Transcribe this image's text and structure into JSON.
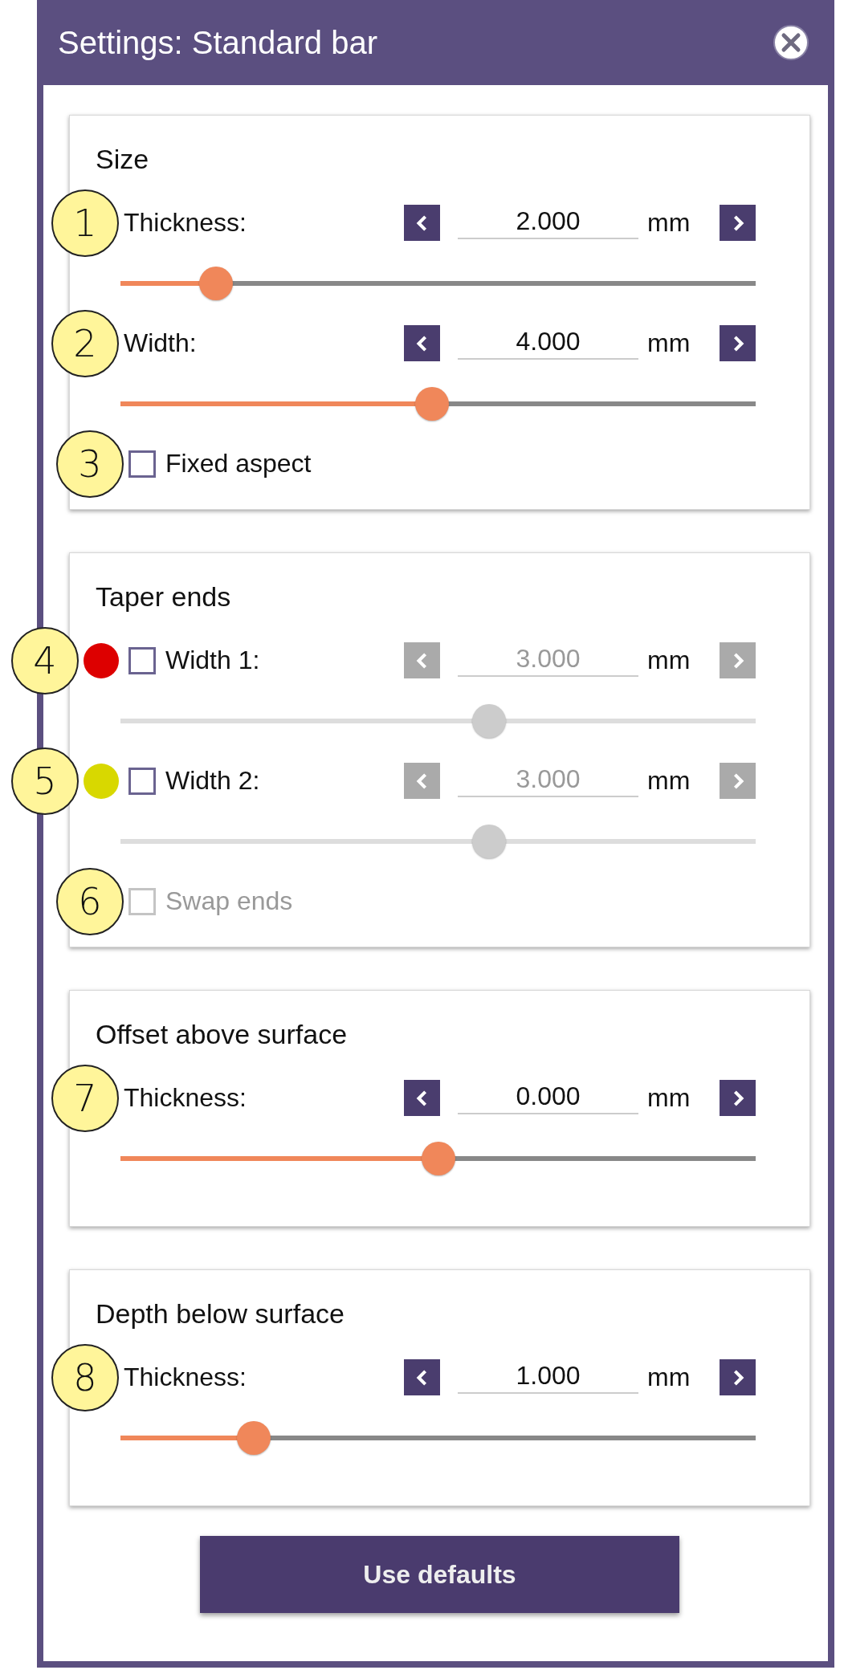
{
  "window": {
    "title": "Settings: Standard bar"
  },
  "panels": [
    {
      "title": "Size",
      "items": [
        {
          "kind": "value",
          "callout": "1",
          "label": "Thickness:",
          "value": "2.000",
          "unit": "mm",
          "level": 0.15,
          "disabled": false
        },
        {
          "kind": "value",
          "callout": "2",
          "label": "Width:",
          "value": "4.000",
          "unit": "mm",
          "level": 0.49,
          "disabled": false
        },
        {
          "kind": "checkbox",
          "callout": "3",
          "label": "Fixed aspect",
          "checked": false,
          "disabled": false
        }
      ]
    },
    {
      "title": "Taper ends",
      "items": [
        {
          "kind": "toggle_value",
          "callout": "4",
          "color": "#dd0000",
          "checked": false,
          "label": "Width 1:",
          "value": "3.000",
          "unit": "mm",
          "level": 0.58,
          "disabled": true
        },
        {
          "kind": "toggle_value",
          "callout": "5",
          "color": "#d8d800",
          "checked": false,
          "label": "Width 2:",
          "value": "3.000",
          "unit": "mm",
          "level": 0.58,
          "disabled": true
        },
        {
          "kind": "checkbox",
          "callout": "6",
          "label": "Swap ends",
          "checked": false,
          "disabled": true
        }
      ]
    },
    {
      "title": "Offset above surface",
      "items": [
        {
          "kind": "value",
          "callout": "7",
          "label": "Thickness:",
          "value": "0.000",
          "unit": "mm",
          "level": 0.5,
          "disabled": false
        }
      ]
    },
    {
      "title": "Depth below surface",
      "items": [
        {
          "kind": "value",
          "callout": "8",
          "label": "Thickness:",
          "value": "1.000",
          "unit": "mm",
          "level": 0.21,
          "disabled": false
        }
      ]
    }
  ],
  "button": "Use defaults"
}
